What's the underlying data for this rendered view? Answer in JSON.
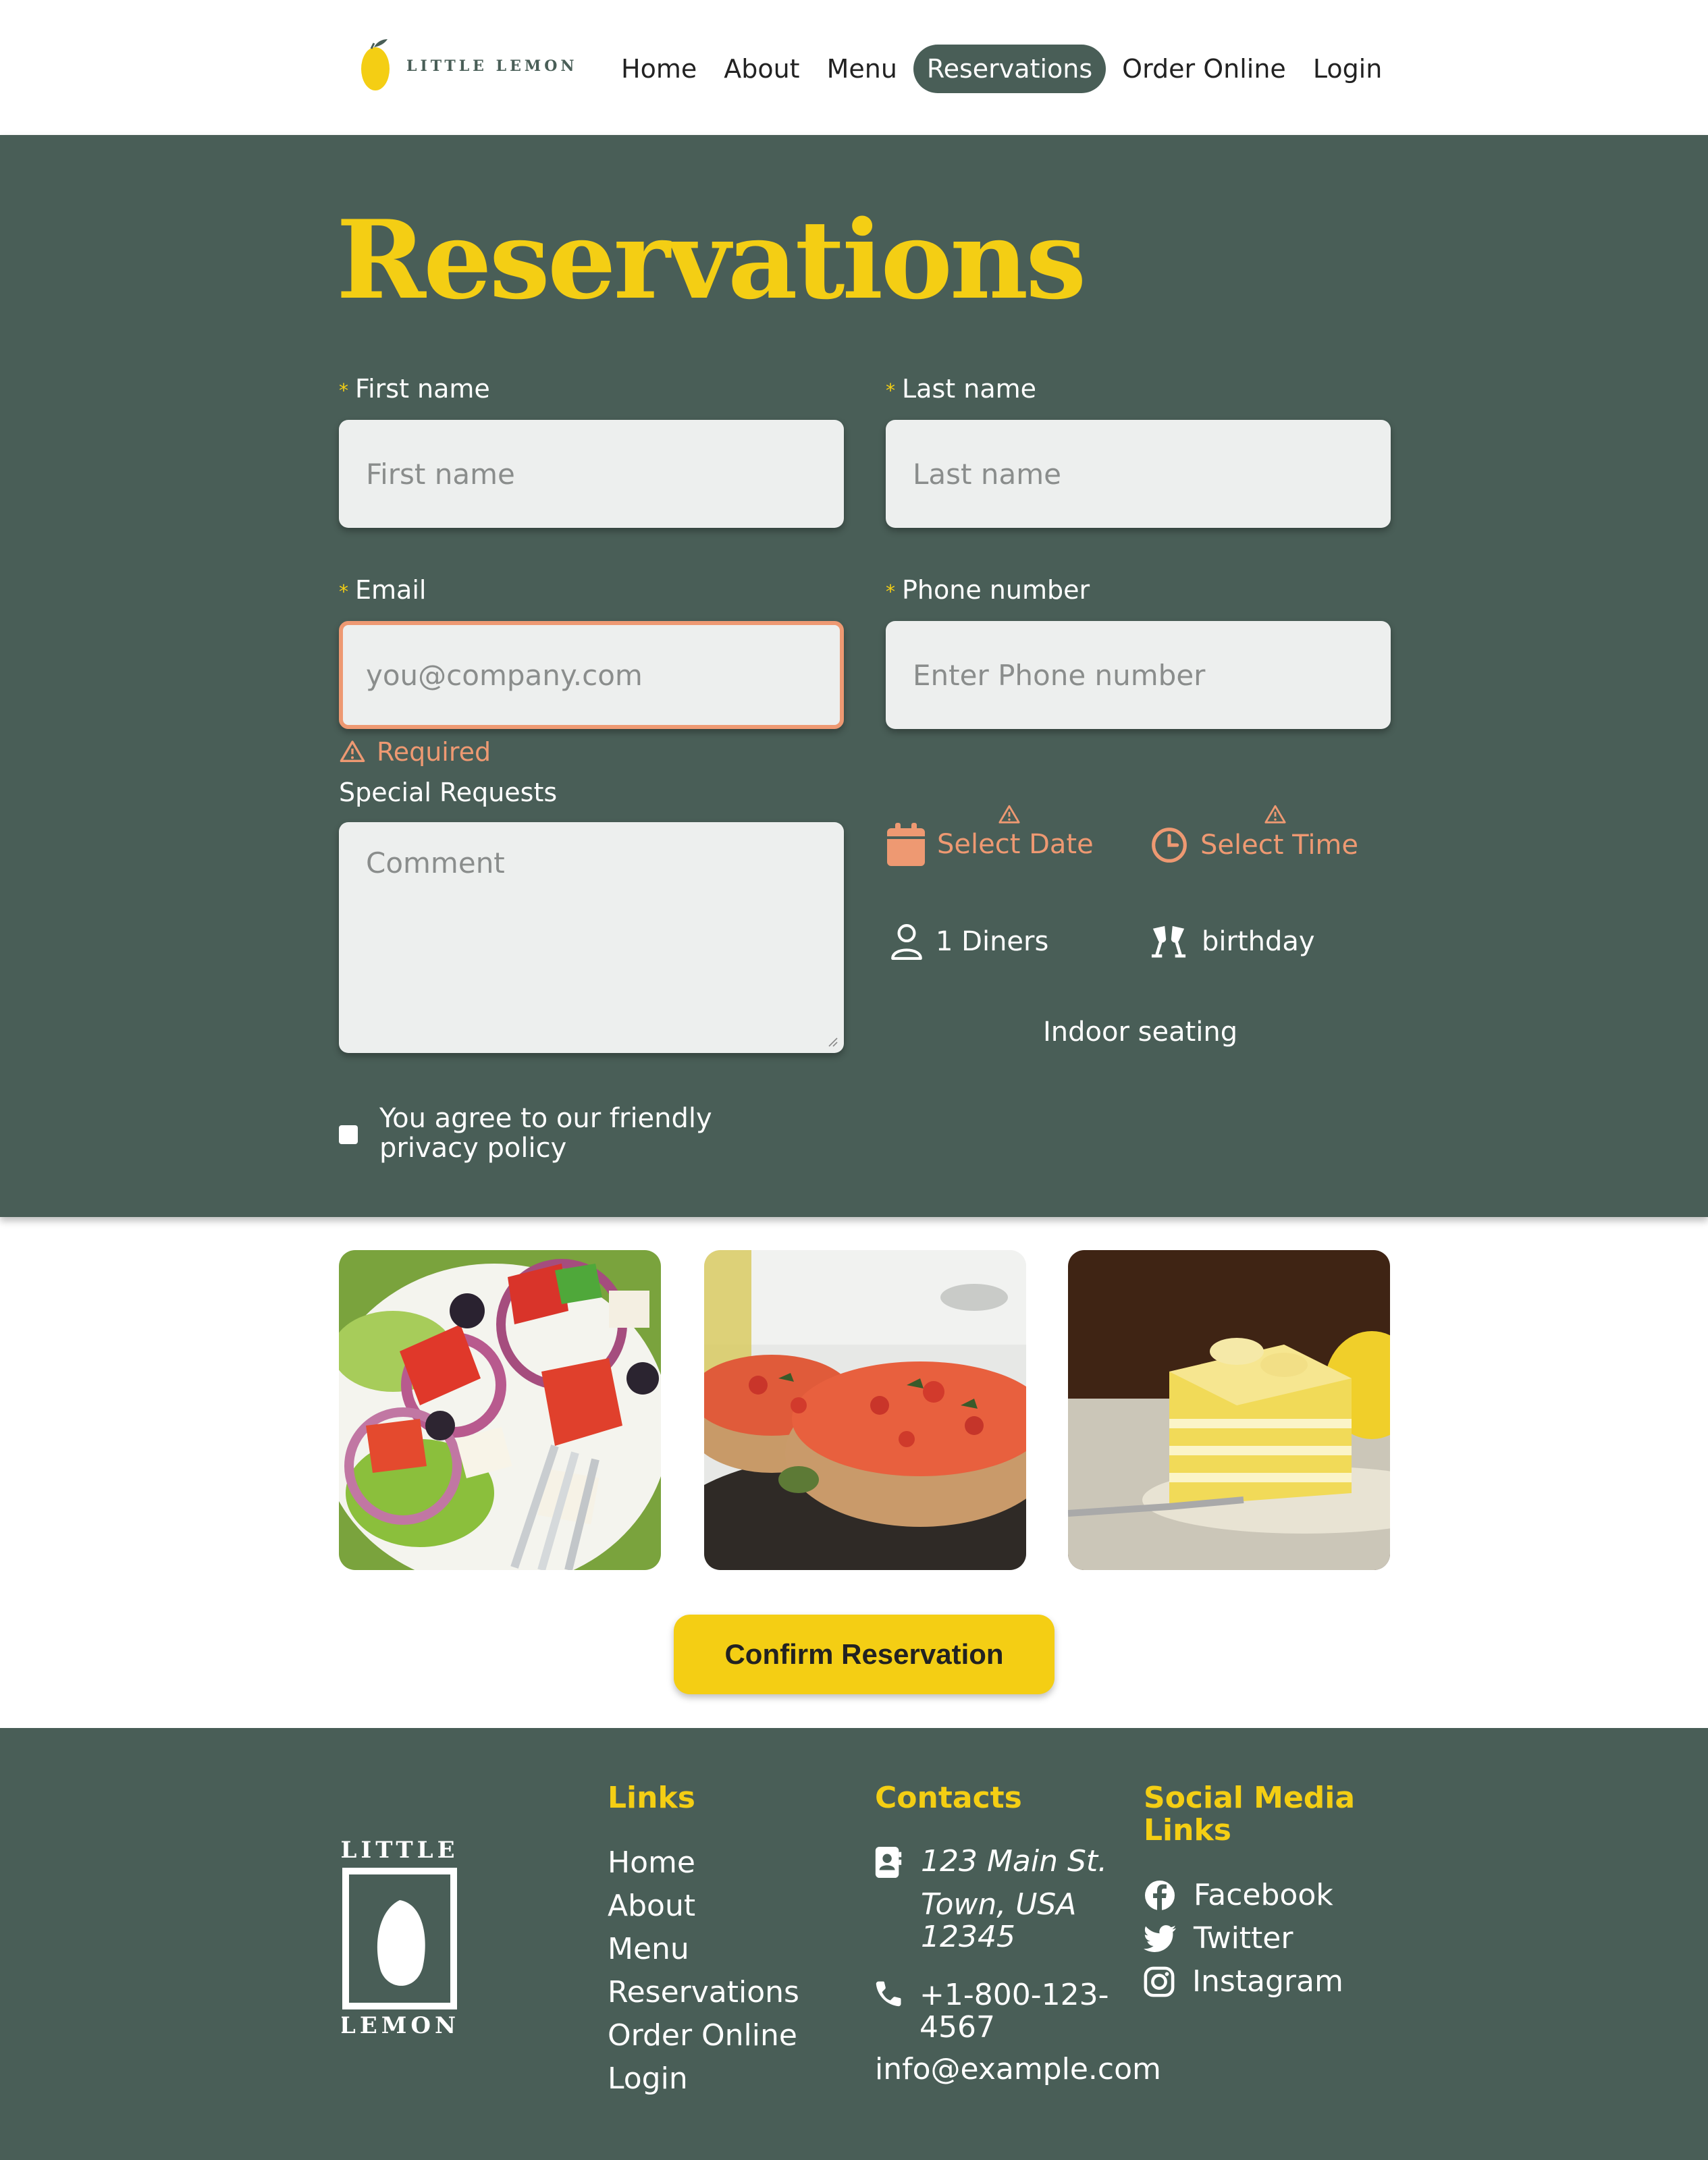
{
  "brand": {
    "logo_text": "LITTLE LEMON"
  },
  "nav": {
    "items": [
      {
        "label": "Home"
      },
      {
        "label": "About"
      },
      {
        "label": "Menu"
      },
      {
        "label": "Reservations",
        "active": true
      },
      {
        "label": "Order Online"
      },
      {
        "label": "Login"
      }
    ]
  },
  "form": {
    "title": "Reservations",
    "first_name": {
      "label": "First name",
      "placeholder": "First name",
      "required": "*"
    },
    "last_name": {
      "label": "Last name",
      "placeholder": "Last name",
      "required": "*"
    },
    "email": {
      "label": "Email",
      "placeholder": "you@company.com",
      "required": "*",
      "error": "Required"
    },
    "phone": {
      "label": "Phone number",
      "placeholder": "Enter Phone number",
      "required": "*"
    },
    "special_requests": {
      "label": "Special Requests",
      "placeholder": "Comment"
    },
    "date_picker": {
      "label": "Select Date",
      "icon": "calendar-icon"
    },
    "time_picker": {
      "label": "Select Time",
      "icon": "clock-icon"
    },
    "diners": {
      "label": "1 Diners",
      "icon": "person-icon"
    },
    "occasion": {
      "label": "birthday",
      "icon": "cheers-icon"
    },
    "seating": {
      "label": "Indoor seating"
    },
    "privacy": {
      "label": "You agree to our friendly privacy policy"
    },
    "confirm_label": "Confirm Reservation"
  },
  "gallery": [
    {
      "name": "greek salad"
    },
    {
      "name": "bruschetta"
    },
    {
      "name": "lemon cake"
    }
  ],
  "footer": {
    "logo_top": "LITTLE",
    "logo_bottom": "LEMON",
    "links_title": "Links",
    "links": [
      "Home",
      "About",
      "Menu",
      "Reservations",
      "Order Online",
      "Login"
    ],
    "contacts_title": "Contacts",
    "address": [
      "123 Main St.",
      "Town, USA",
      "12345"
    ],
    "phone": [
      "+1-800-123-",
      "4567"
    ],
    "email": "info@example.com",
    "social_title": [
      "Social Media",
      "Links"
    ],
    "social": [
      {
        "label": "Facebook",
        "icon": "facebook-icon"
      },
      {
        "label": "Twitter",
        "icon": "twitter-icon"
      },
      {
        "label": "Instagram",
        "icon": "instagram-icon"
      }
    ]
  },
  "colors": {
    "primary_green": "#495e57",
    "primary_yellow": "#f4ce14",
    "accent_salmon": "#ee9972",
    "field_bg": "#edefee"
  }
}
